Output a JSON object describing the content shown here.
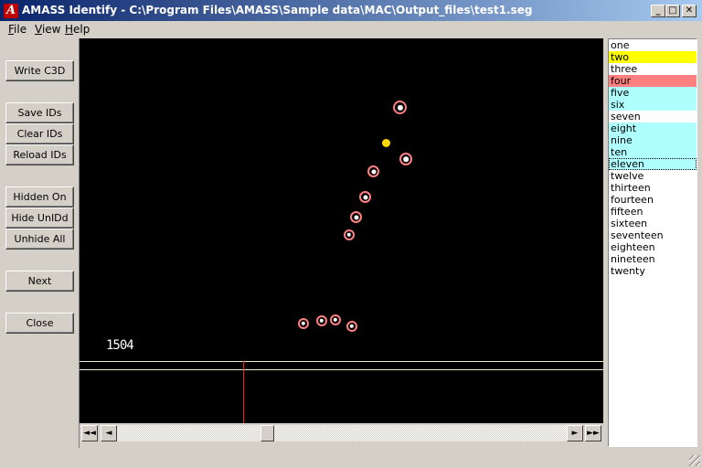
{
  "window": {
    "title": "AMASS Identify  -  C:\\Program Files\\AMASS\\Sample data\\MAC\\Output_files\\test1.seg",
    "icon": "A",
    "controls": [
      "_",
      "□",
      "✕"
    ]
  },
  "menu": {
    "items": [
      "File",
      "View",
      "Help"
    ]
  },
  "buttons": {
    "write_c3d": "Write C3D",
    "save_ids": "Save IDs",
    "clear_ids": "Clear IDs",
    "reload_ids": "Reload IDs",
    "hidden_on": "Hidden On",
    "hide_unidd": "Hide UnIDd",
    "unhide_all": "Unhide All",
    "next": "Next",
    "close": "Close"
  },
  "viewport": {
    "frame_number": "1504",
    "background": "#000000",
    "marker_ring_color": "#ff8080",
    "selected_marker_color": "#ffd700"
  },
  "scrollbar": {
    "first": "◄◄",
    "prev": "◄",
    "next": "►",
    "last": "►►",
    "position": 0.33
  },
  "id_list": {
    "items": [
      {
        "label": "one",
        "bg": "#ffffff"
      },
      {
        "label": "two",
        "bg": "#ffff00"
      },
      {
        "label": "three",
        "bg": "#ffffff"
      },
      {
        "label": "four",
        "bg": "#ff8080"
      },
      {
        "label": "five",
        "bg": "#b0ffff"
      },
      {
        "label": "six",
        "bg": "#b0ffff"
      },
      {
        "label": "seven",
        "bg": "#ffffff"
      },
      {
        "label": "eight",
        "bg": "#b0ffff"
      },
      {
        "label": "nine",
        "bg": "#b0ffff"
      },
      {
        "label": "ten",
        "bg": "#b0ffff"
      },
      {
        "label": "eleven",
        "bg": "#b0ffff",
        "focused": true
      },
      {
        "label": "twelve",
        "bg": "#ffffff"
      },
      {
        "label": "thirteen",
        "bg": "#ffffff"
      },
      {
        "label": "fourteen",
        "bg": "#ffffff"
      },
      {
        "label": "fifteen",
        "bg": "#ffffff"
      },
      {
        "label": "sixteen",
        "bg": "#ffffff"
      },
      {
        "label": "seventeen",
        "bg": "#ffffff"
      },
      {
        "label": "eighteen",
        "bg": "#ffffff"
      },
      {
        "label": "nineteen",
        "bg": "#ffffff"
      },
      {
        "label": "twenty",
        "bg": "#ffffff"
      }
    ]
  }
}
